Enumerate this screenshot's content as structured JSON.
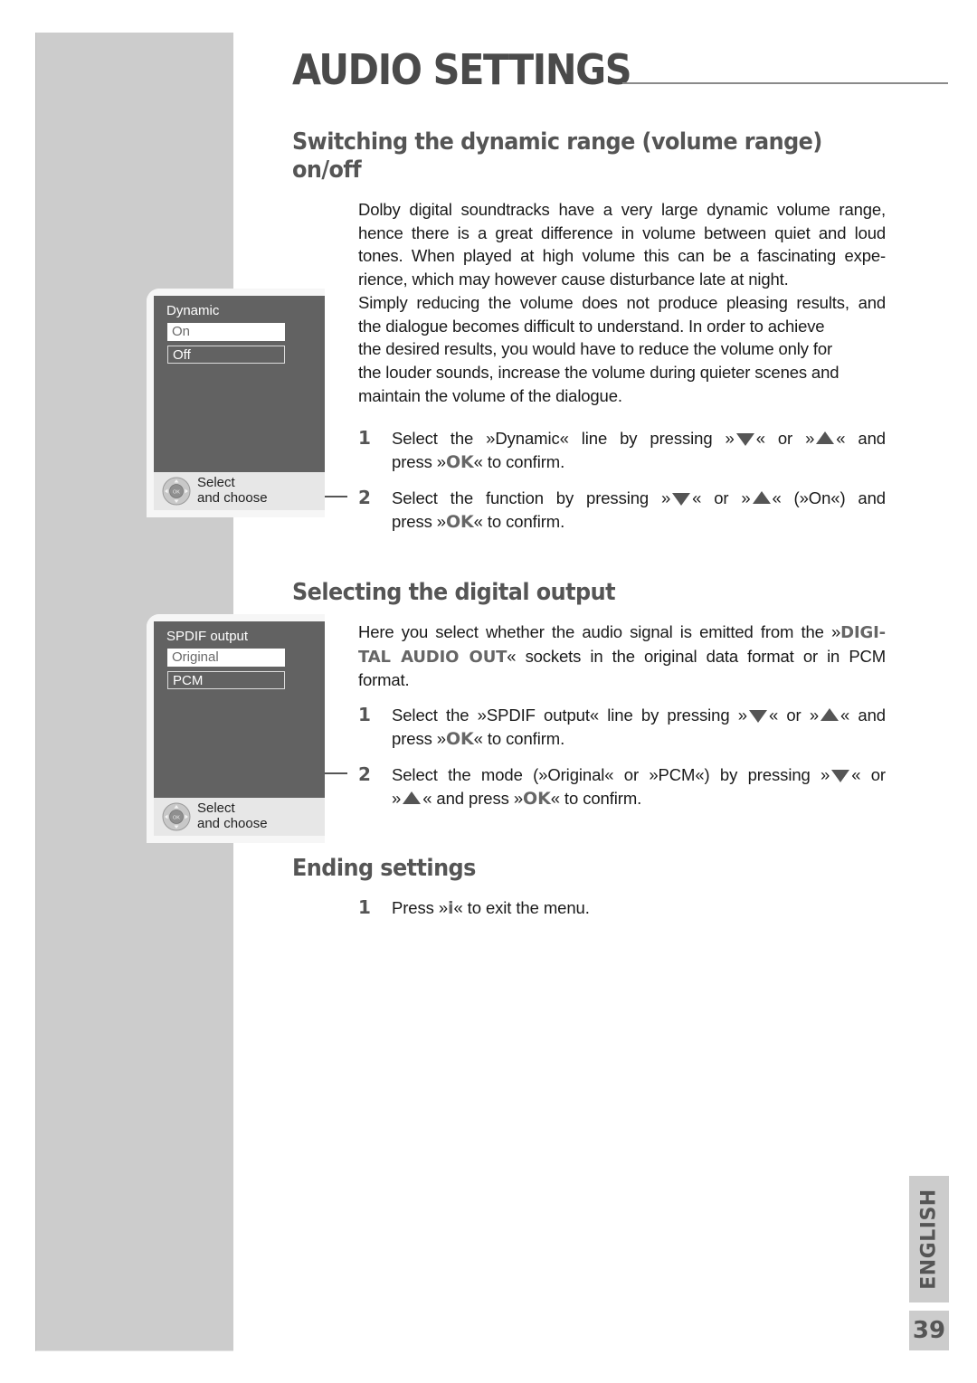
{
  "page": {
    "title": "AUDIO SETTINGS",
    "language_tab": "ENGLISH",
    "page_number": "39",
    "colors": {
      "sidebar": "#cccccc",
      "heading": "#555555",
      "osd_panel": "#626262",
      "osd_footer": "#e7e7e7"
    }
  },
  "sections": [
    {
      "heading_line1": "Switching the dynamic range (volume range)",
      "heading_line2": "on/off",
      "paragraph": "Dolby digital soundtracks have a very large dynamic volume range, hence there is a great difference in volume between quiet and loud tones. When played at high volume this can be a fascinating expe-rience, which may however cause disturbance late at night. Simply reducing the volume does not produce pleasing results, and the dialogue becomes difficult to understand. In order to achieve the desired results, you would have to reduce the volume only for the louder sounds, increase the volume during quieter scenes and maintain the volume of the dialogue.",
      "paragraph_lines": [
        "Dolby digital soundtracks have a very large dynamic volume range,",
        "hence there is a great difference in volume between quiet and loud",
        "tones. When played at high volume this can be a fascinating expe-",
        "rience, which may however cause disturbance late at night.",
        "Simply reducing the volume does not produce pleasing results, and",
        "the dialogue becomes difficult to understand. In order to achieve",
        "the desired results, you would have to reduce the volume only for",
        "the louder sounds, increase the volume during quieter scenes and",
        "maintain the volume of the dialogue."
      ],
      "steps": [
        {
          "number": "1",
          "a": "Select the »Dynamic« line by pressing »",
          "b": "« or »",
          "c": "« and",
          "d": "press »",
          "ok": "OK",
          "e": "« to confirm."
        },
        {
          "number": "2",
          "a": "Select the function by pressing »",
          "b": "« or »",
          "c": "« (»On«) and",
          "d": "press »",
          "ok": "OK",
          "e": "« to confirm."
        }
      ],
      "osd": {
        "title": "Dynamic",
        "options": [
          {
            "label": "On",
            "selected": true
          },
          {
            "label": "Off",
            "selected": false
          }
        ],
        "footer_line1": "Select",
        "footer_line2": "and choose",
        "remote_icon": "remote-navigation-ok-icon"
      }
    },
    {
      "heading_line1": "Selecting the digital output",
      "paragraph_a": "Here you select whether the audio signal is emitted from the »",
      "paragraph_strong1": "DIGI-",
      "paragraph_strong2": "TAL AUDIO OUT",
      "paragraph_b": "« sockets in the original data format or in PCM",
      "paragraph_c": "format.",
      "steps": [
        {
          "number": "1",
          "a": "Select the »SPDIF output« line by pressing »",
          "b": "« or »",
          "c": "« and",
          "d": "press »",
          "ok": "OK",
          "e": "« to confirm."
        },
        {
          "number": "2",
          "a": "Select the mode (»Original« or »PCM«) by pressing »",
          "b": "« or",
          "c": "»",
          "d": "« and press »",
          "ok": "OK",
          "e": "« to confirm."
        }
      ],
      "osd": {
        "title": "SPDIF output",
        "options": [
          {
            "label": "Original",
            "selected": true
          },
          {
            "label": "PCM",
            "selected": false
          }
        ],
        "footer_line1": "Select",
        "footer_line2": "and choose",
        "remote_icon": "remote-navigation-ok-icon"
      }
    },
    {
      "heading_line1": "Ending settings",
      "steps": [
        {
          "number": "1",
          "a": "Press »",
          "key": "i",
          "b": "« to exit the menu."
        }
      ]
    }
  ]
}
